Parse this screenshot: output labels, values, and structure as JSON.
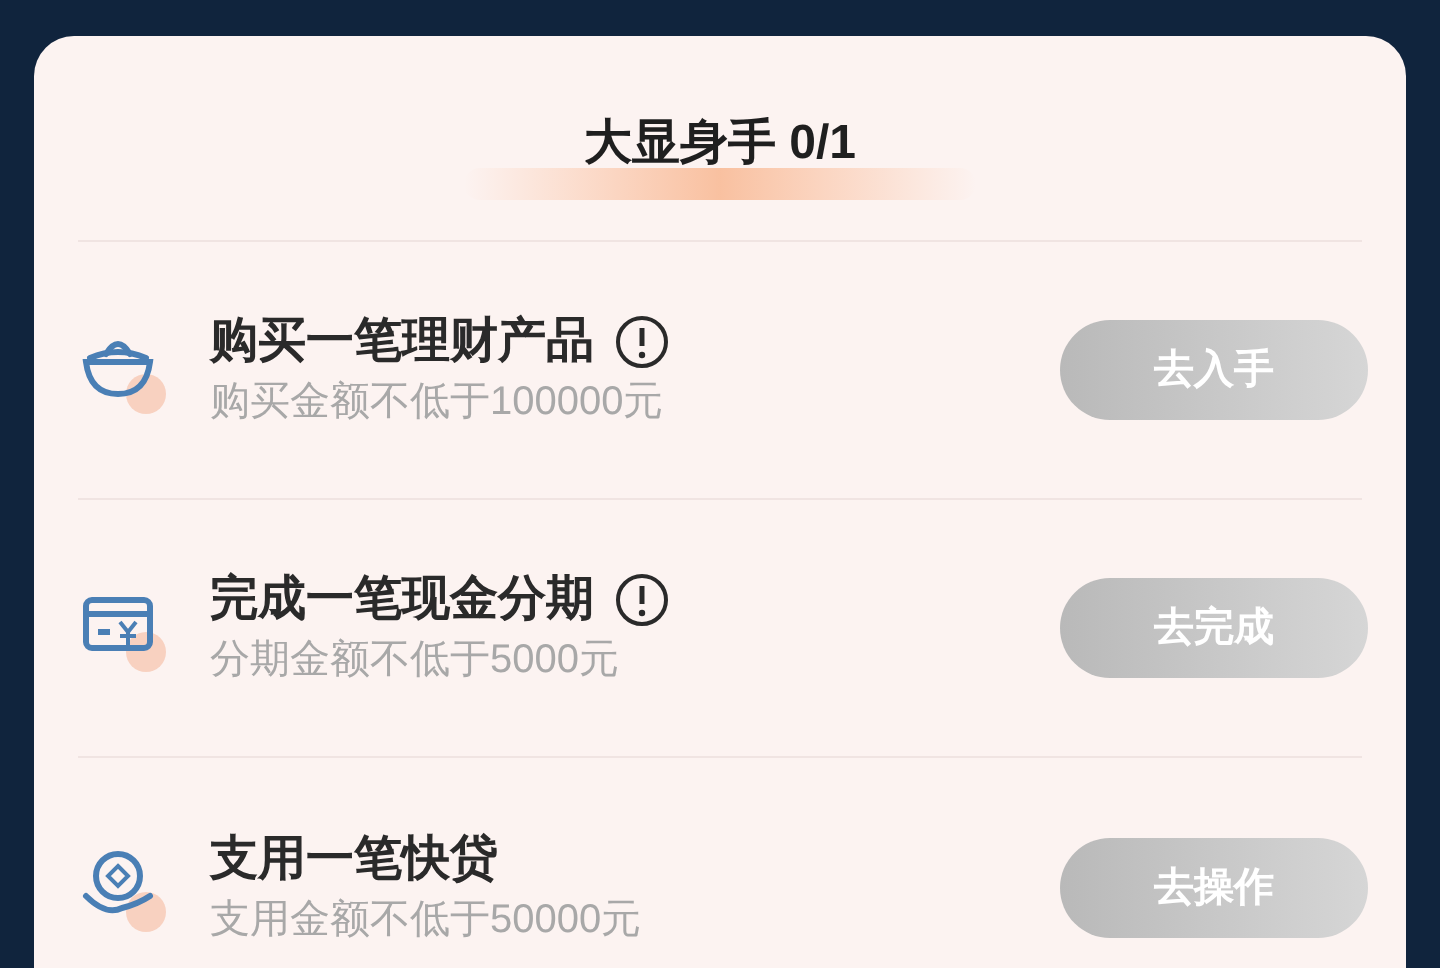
{
  "header": {
    "title": "大显身手 0/1"
  },
  "tasks": [
    {
      "kind": "ingot",
      "title": "购买一笔理财产品",
      "info": true,
      "subtitle": "购买金额不低于100000元",
      "button": "去入手"
    },
    {
      "kind": "card",
      "title": "完成一笔现金分期",
      "info": true,
      "subtitle": "分期金额不低于5000元",
      "button": "去完成"
    },
    {
      "kind": "coin",
      "title": "支用一笔快贷",
      "info": false,
      "subtitle": "支用金额不低于50000元",
      "button": "去操作"
    }
  ]
}
